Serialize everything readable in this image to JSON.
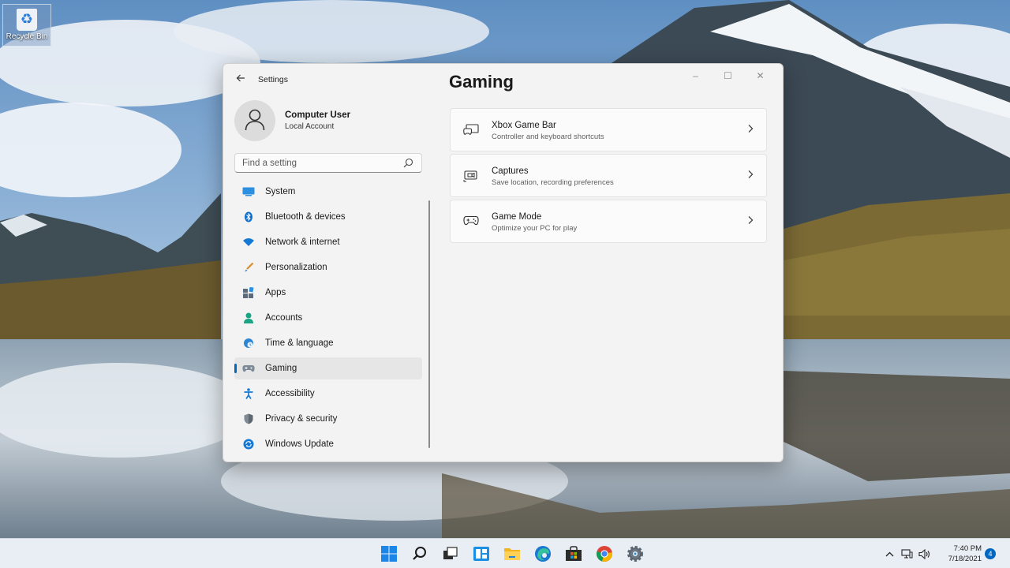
{
  "desktop": {
    "recycle_bin_label": "Recycle Bin"
  },
  "window": {
    "app_title": "Settings",
    "back_icon": "arrow-left-icon",
    "controls": {
      "minimize": "–",
      "maximize": "☐",
      "close": "✕"
    },
    "profile": {
      "name": "Computer User",
      "account": "Local Account"
    },
    "search": {
      "placeholder": "Find a setting",
      "value": ""
    },
    "nav_items": [
      {
        "label": "System",
        "icon": "system-icon",
        "active": false
      },
      {
        "label": "Bluetooth & devices",
        "icon": "bluetooth-icon",
        "active": false
      },
      {
        "label": "Network & internet",
        "icon": "wifi-icon",
        "active": false
      },
      {
        "label": "Personalization",
        "icon": "brush-icon",
        "active": false
      },
      {
        "label": "Apps",
        "icon": "apps-icon",
        "active": false
      },
      {
        "label": "Accounts",
        "icon": "person-icon",
        "active": false
      },
      {
        "label": "Time & language",
        "icon": "globe-clock-icon",
        "active": false
      },
      {
        "label": "Gaming",
        "icon": "controller-icon",
        "active": true
      },
      {
        "label": "Accessibility",
        "icon": "accessibility-icon",
        "active": false
      },
      {
        "label": "Privacy & security",
        "icon": "shield-icon",
        "active": false
      },
      {
        "label": "Windows Update",
        "icon": "update-icon",
        "active": false
      }
    ],
    "page_title": "Gaming",
    "cards": [
      {
        "title": "Xbox Game Bar",
        "subtitle": "Controller and keyboard shortcuts",
        "icon": "game-bar-icon"
      },
      {
        "title": "Captures",
        "subtitle": "Save location, recording preferences",
        "icon": "capture-icon"
      },
      {
        "title": "Game Mode",
        "subtitle": "Optimize your PC for play",
        "icon": "game-mode-icon"
      }
    ]
  },
  "taskbar": {
    "apps": [
      "start-icon",
      "search-icon",
      "task-view-icon",
      "widgets-icon",
      "file-explorer-icon",
      "edge-icon",
      "store-icon",
      "chrome-icon",
      "settings-icon"
    ],
    "tray": {
      "chevron": "^",
      "network_icon": "network-icon",
      "volume_icon": "volume-icon"
    },
    "time": "7:40 PM",
    "date": "7/18/2021",
    "notification_count": "4"
  },
  "colors": {
    "accent": "#0067c0",
    "window_bg": "#f3f3f3",
    "card_bg": "#fbfbfb",
    "taskbar_bg": "#e9eef5"
  }
}
